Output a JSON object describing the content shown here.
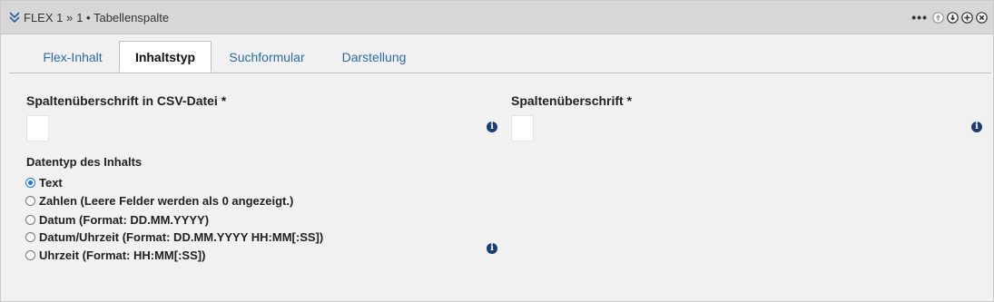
{
  "header": {
    "title": "FLEX 1 »",
    "subtitle": "1 • Tabellenspalte",
    "more_label": "•••"
  },
  "tabs": [
    {
      "label": "Flex-Inhalt",
      "active": false
    },
    {
      "label": "Inhaltstyp",
      "active": true
    },
    {
      "label": "Suchformular",
      "active": false
    },
    {
      "label": "Darstellung",
      "active": false
    }
  ],
  "form": {
    "csv_heading_label": "Spaltenüberschrift in CSV-Datei *",
    "csv_heading_value": "",
    "heading_label": "Spaltenüberschrift *",
    "heading_value": "",
    "datatype_label": "Datentyp des Inhalts",
    "info_glyph": "i",
    "datatype_options": [
      {
        "label": "Text",
        "checked": true
      },
      {
        "label": "Zahlen (Leere Felder werden als 0 angezeigt.)",
        "checked": false
      },
      {
        "label": "Datum (Format: DD.MM.YYYY)",
        "checked": false
      },
      {
        "label": "Datum/Uhrzeit (Format: DD.MM.YYYY HH:MM[:SS])",
        "checked": false
      },
      {
        "label": "Uhrzeit (Format: HH:MM[:SS])",
        "checked": false
      }
    ]
  },
  "colors": {
    "header_bg": "#d7d7d7",
    "panel_bg": "#f1f1f1",
    "tab_link": "#2a6aa6",
    "info_icon": "#1a3f78",
    "radio_checked": "#1a73e8"
  }
}
